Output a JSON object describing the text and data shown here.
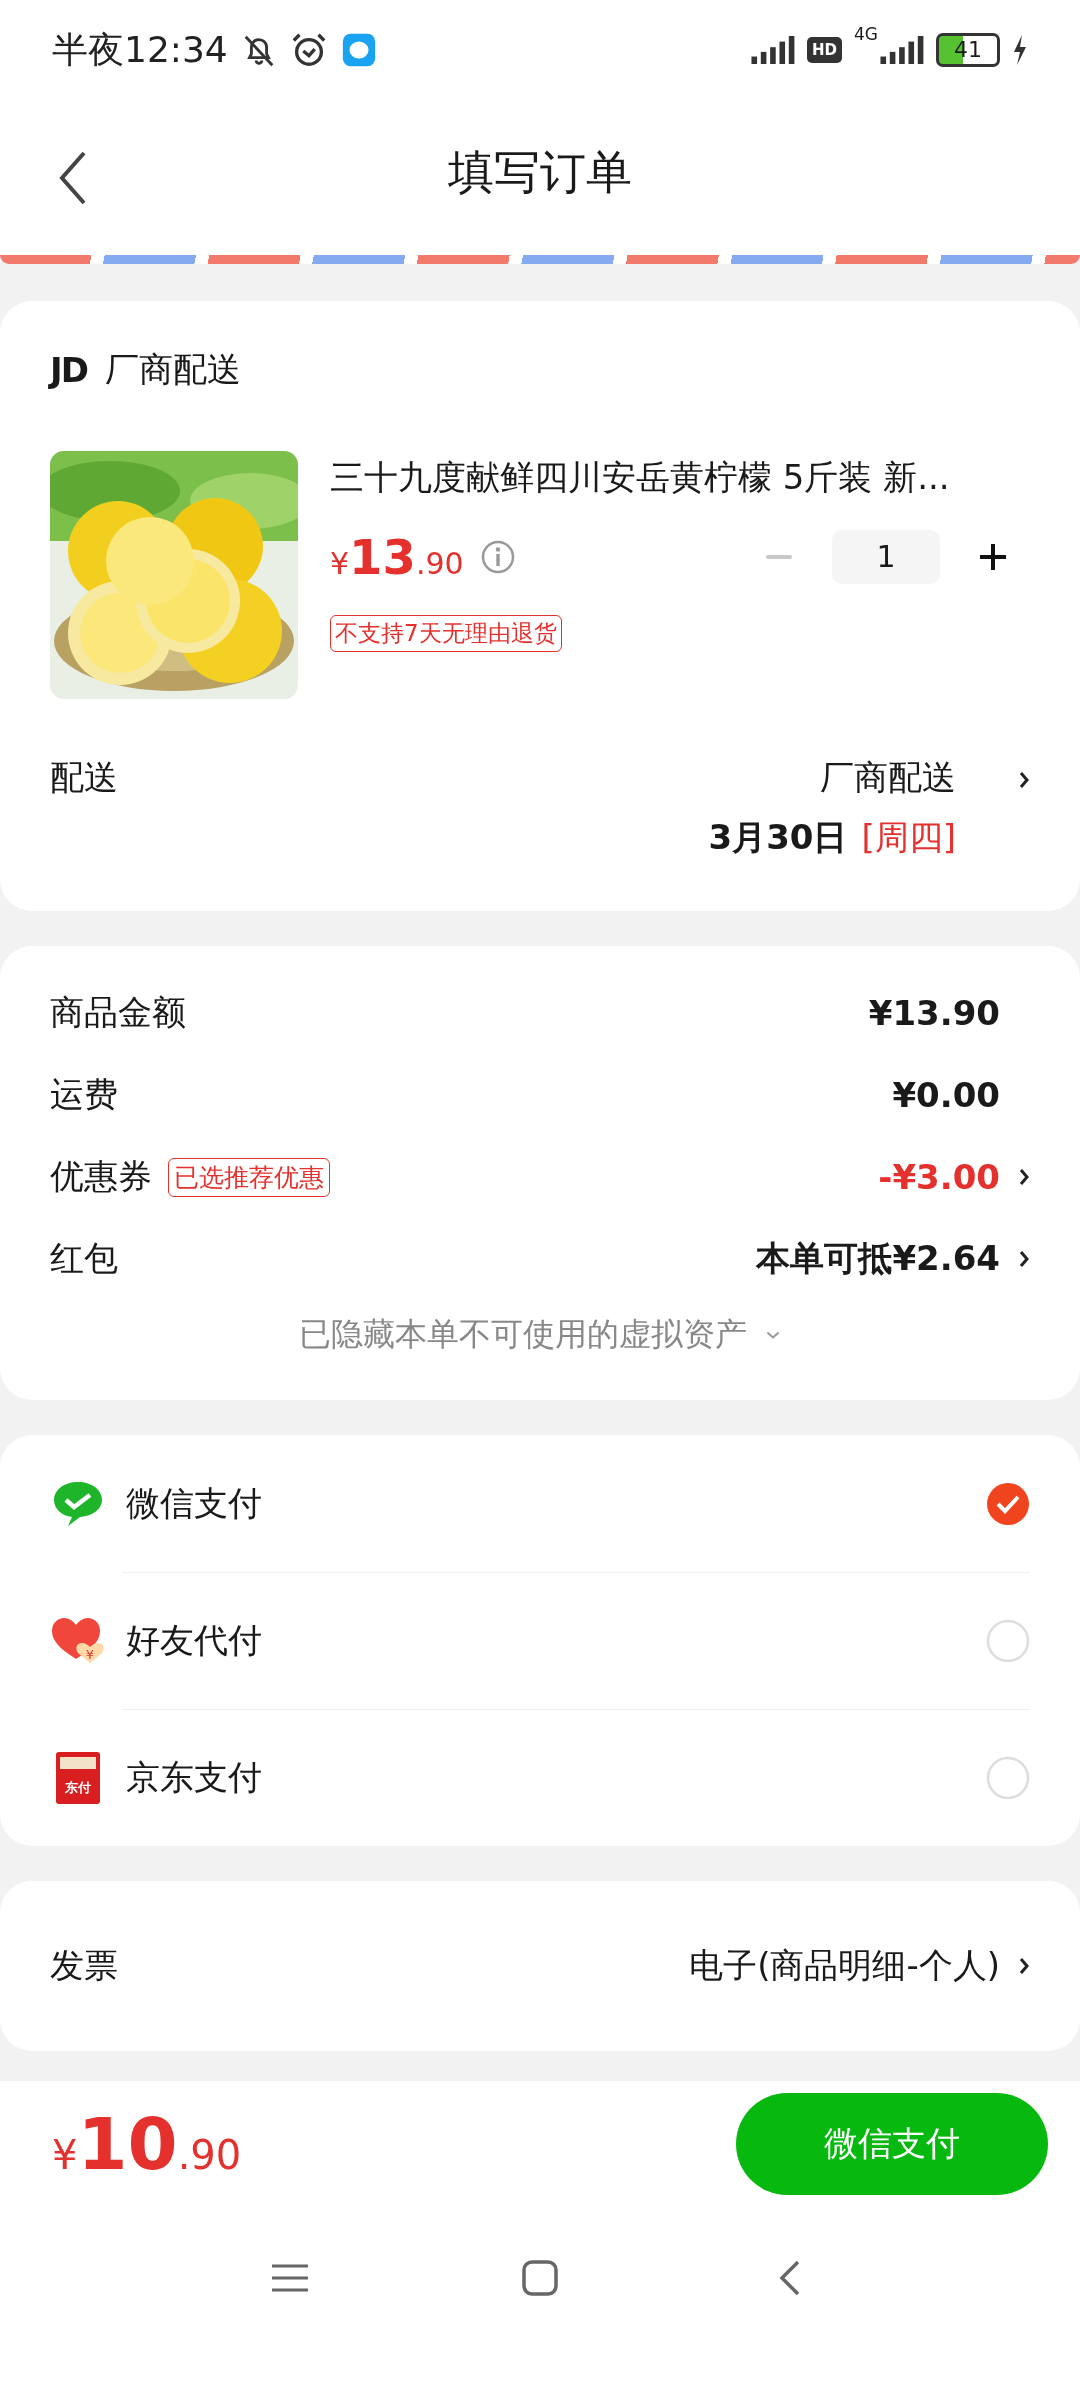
{
  "status_bar": {
    "time": "半夜12:34",
    "hd": "HD",
    "network": "4G",
    "battery": "41"
  },
  "header": {
    "title": "填写订单"
  },
  "shipment": {
    "seller_logo": "JD",
    "seller": "厂商配送",
    "product": {
      "title": "三十九度献鲜四川安岳黄柠檬  5斤装 新...",
      "currency": "¥",
      "price_int": "13",
      "price_dec": ".90",
      "quantity": "1",
      "tag": "不支持7天无理由退货"
    },
    "delivery": {
      "label": "配送",
      "method": "厂商配送",
      "date": "3月30日",
      "weekday": "[周四]"
    }
  },
  "summary": {
    "rows": [
      {
        "label": "商品金额",
        "value": "¥13.90",
        "kind": "plain"
      },
      {
        "label": "运费",
        "value": "¥0.00",
        "kind": "plain"
      },
      {
        "label": "优惠券",
        "badge": "已选推荐优惠",
        "value": "-¥3.00",
        "kind": "discount"
      },
      {
        "label": "红包",
        "value": "本单可抵¥2.64",
        "kind": "link"
      }
    ],
    "hidden_note": "已隐藏本单不可使用的虚拟资产"
  },
  "payment_methods": [
    {
      "name": "微信支付",
      "kind": "wechat",
      "selected": true
    },
    {
      "name": "好友代付",
      "kind": "friend",
      "icon_text": "¥",
      "selected": false
    },
    {
      "name": "京东支付",
      "kind": "jdpay",
      "icon_text": "东付",
      "selected": false
    }
  ],
  "invoice": {
    "label": "发票",
    "value": "电子(商品明细-个人)"
  },
  "footer": {
    "currency": "¥",
    "total_int": "10",
    "total_dec": ".90",
    "pay_button": "微信支付"
  }
}
